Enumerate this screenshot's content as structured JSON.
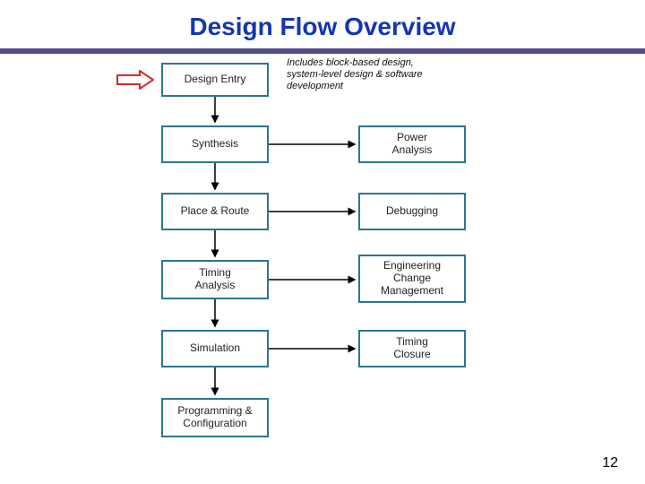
{
  "title": "Design Flow Overview",
  "page_number": "12",
  "annotation": "Includes block-based design, system-level design & software development",
  "colors": {
    "title": "#1436b0",
    "bar": "#504d8a",
    "box_border": "#2b7690",
    "pointer_outline": "#d7262b"
  },
  "left_column": [
    {
      "id": "design-entry",
      "label": "Design Entry"
    },
    {
      "id": "synthesis",
      "label": "Synthesis"
    },
    {
      "id": "place-route",
      "label": "Place & Route"
    },
    {
      "id": "timing-analysis",
      "label": "Timing\nAnalysis"
    },
    {
      "id": "simulation",
      "label": "Simulation"
    },
    {
      "id": "prog-config",
      "label": "Programming &\nConfiguration"
    }
  ],
  "right_column": [
    {
      "id": "power-analysis",
      "label": "Power\nAnalysis"
    },
    {
      "id": "debugging",
      "label": "Debugging"
    },
    {
      "id": "ecm",
      "label": "Engineering\nChange\nManagement"
    },
    {
      "id": "timing-closure",
      "label": "Timing\nClosure"
    }
  ],
  "connections": {
    "vertical_sequence": [
      "design-entry",
      "synthesis",
      "place-route",
      "timing-analysis",
      "simulation",
      "prog-config"
    ],
    "horizontal": [
      {
        "from": "synthesis",
        "to": "power-analysis"
      },
      {
        "from": "place-route",
        "to": "debugging"
      },
      {
        "from": "timing-analysis",
        "to": "ecm"
      },
      {
        "from": "simulation",
        "to": "timing-closure"
      }
    ]
  }
}
